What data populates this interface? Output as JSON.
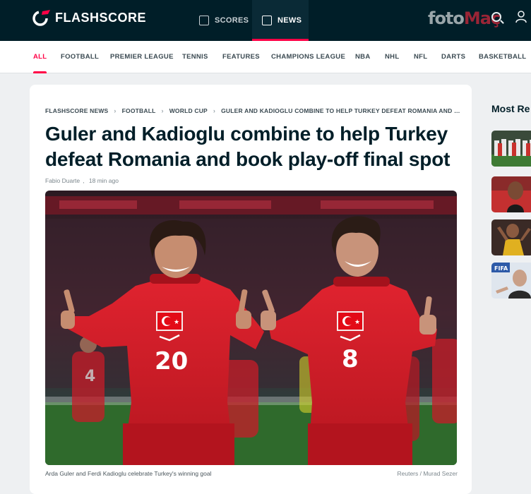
{
  "header": {
    "brand": "FLASHSCORE",
    "nav": {
      "scores": "SCORES",
      "news": "NEWS"
    },
    "watermark_a": "foto",
    "watermark_b": "Maç"
  },
  "categories": [
    "ALL",
    "FOOTBALL",
    "PREMIER LEAGUE",
    "TENNIS",
    "FEATURES",
    "CHAMPIONS LEAGUE",
    "NBA",
    "NHL",
    "NFL",
    "DARTS",
    "BASKETBALL"
  ],
  "article": {
    "breadcrumb": [
      "FLASHSCORE NEWS",
      "FOOTBALL",
      "WORLD CUP",
      "GULER AND KADIOGLU COMBINE TO HELP TURKEY DEFEAT ROMANIA AND BO..."
    ],
    "title": "Guler and Kadioglu combine to help Turkey defeat Romania and book play-off final spot",
    "author": "Fabio Duarte",
    "time": "18 min ago",
    "caption": "Arda Guler and Ferdi Kadioglu celebrate Turkey's winning goal",
    "credit": "Reuters / Murad Sezer",
    "players": {
      "left_number": "20",
      "right_number": "8",
      "bg_number": "4"
    }
  },
  "sidebar": {
    "title": "Most Re"
  },
  "colors": {
    "accent": "#ff0046",
    "header_bg": "#001e28",
    "jersey": "#d8202c"
  }
}
